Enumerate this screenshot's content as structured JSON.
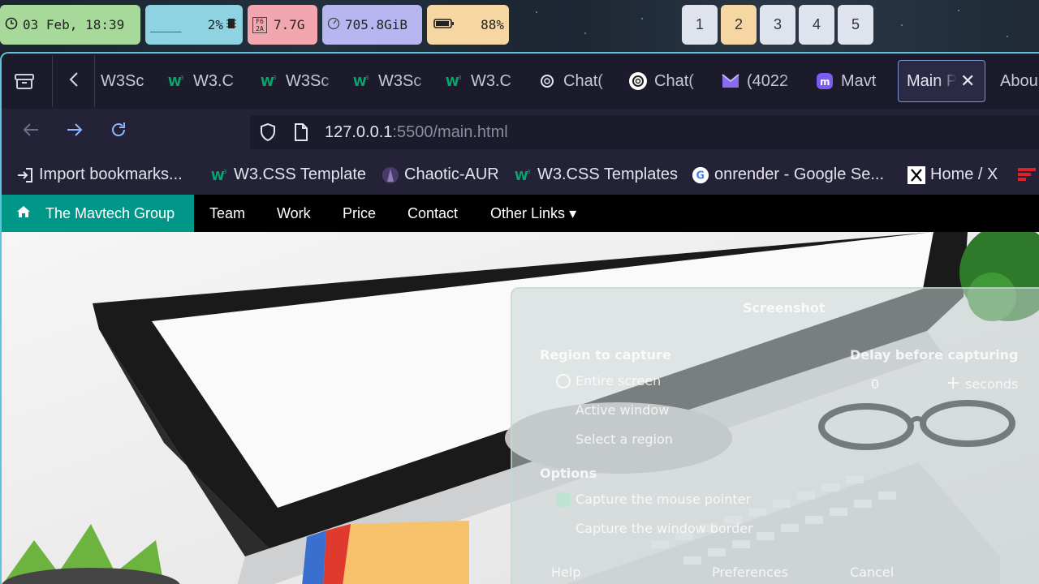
{
  "topbar": {
    "clock": "03 Feb, 18:39",
    "cpu_bar": "____",
    "cpu": "2%",
    "memory_icon": "F6 2A",
    "memory": "7.7G",
    "disk": "705.8GiB",
    "battery": "88%",
    "workspaces": [
      "1",
      "2",
      "3",
      "4",
      "5"
    ],
    "active_workspace": "2"
  },
  "browser": {
    "tabs": [
      {
        "title": "W3Sc",
        "icon": "w3-icon"
      },
      {
        "title": "W3.C",
        "icon": "w3-icon"
      },
      {
        "title": "W3Sc",
        "icon": "w3-icon"
      },
      {
        "title": "W3Sc",
        "icon": "w3-icon"
      },
      {
        "title": "W3.C",
        "icon": "w3-icon"
      },
      {
        "title": "Chat(",
        "icon": "openai-icon"
      },
      {
        "title": "Chat(",
        "icon": "openai-icon"
      },
      {
        "title": "(4022",
        "icon": "proton-mail-icon"
      },
      {
        "title": "Mavt",
        "icon": "mastodon-icon"
      },
      {
        "title": "Main P",
        "icon": "",
        "active": true
      },
      {
        "title": "Abou",
        "icon": ""
      }
    ],
    "url_host": "127.0.0.1",
    "url_rest": ":5500/main.html",
    "bookmarks": [
      {
        "label": "Import bookmarks...",
        "icon": "import-icon"
      },
      {
        "label": "W3.CSS Template",
        "icon": "w3-icon"
      },
      {
        "label": "Chaotic-AUR",
        "icon": "chaotic-aur-icon"
      },
      {
        "label": "W3.CSS Templates",
        "icon": "w3-icon"
      },
      {
        "label": "onrender - Google Se...",
        "icon": "google-icon"
      },
      {
        "label": "Home / X",
        "icon": "x-icon"
      }
    ]
  },
  "page": {
    "brand": "The Mavtech Group",
    "nav": [
      "Team",
      "Work",
      "Price",
      "Contact",
      "Other Links"
    ],
    "dropdown_caret": "▾"
  },
  "overlay_dialog": {
    "title": "Screenshot",
    "region_heading": "Region to capture",
    "region_options": [
      "Entire screen",
      "Active window",
      "Select a region"
    ],
    "delay_heading": "Delay before capturing",
    "delay_value": "0",
    "delay_unit": "seconds",
    "options_heading": "Options",
    "option_items": [
      "Capture the mouse pointer",
      "Capture the window border"
    ],
    "help": "Help",
    "preferences": "Preferences",
    "cancel": "Cancel"
  },
  "colors": {
    "accent_teal": "#009688",
    "border_cyan": "#5fc4d9",
    "w3_green": "#04aa6d"
  }
}
